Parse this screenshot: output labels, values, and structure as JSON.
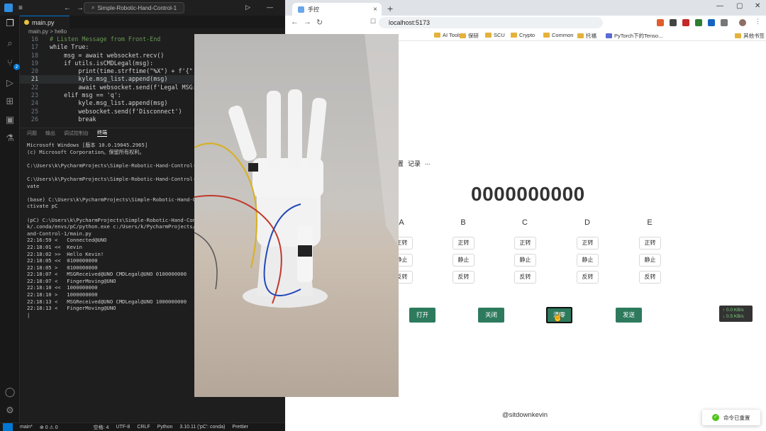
{
  "vscode": {
    "title": "Simple-Robotic-Hand-Control-1",
    "tab": "main.py",
    "breadcrumb": "main.py > hello",
    "code_lines": [
      {
        "n": "16",
        "text": "# Listen Message from Front-End"
      },
      {
        "n": "17",
        "text": "while True:"
      },
      {
        "n": "18",
        "text": "    msg = await websocket.recv()"
      },
      {
        "n": "19",
        "text": "    if utils.isCMDLegal(msg):"
      },
      {
        "n": "20",
        "text": "        print(time.strftime(\"%X\") + f'{\""
      },
      {
        "n": "21",
        "text": "        kyle.msg_list.append(msg)"
      },
      {
        "n": "22",
        "text": "        await websocket.send(f'Legal MSG:"
      },
      {
        "n": "23",
        "text": "    elif msg == 'q':"
      },
      {
        "n": "24",
        "text": "        kyle.msg_list.append(msg)"
      },
      {
        "n": "25",
        "text": "        websocket.send(f'Disconnect')"
      },
      {
        "n": "26",
        "text": "        break"
      }
    ],
    "panel_tabs": [
      "问题",
      "输出",
      "调试控制台",
      "终端"
    ],
    "terminal": [
      "Microsoft Windows [版本 10.0.19045.2965]",
      "(c) Microsoft Corporation。保留所有权利。",
      "",
      "C:\\Users\\k\\PycharmProjects\\Simple-Robotic-Hand-Control-1>act",
      "",
      "C:\\Users\\k\\PycharmProjects\\Simple-Robotic-Hand-Control-1>con",
      "vate",
      "",
      "(base) C:\\Users\\k\\PycharmProjects\\Simple-Robotic-Hand-Contro",
      "ctivate pC",
      "",
      "(pC) C:\\Users\\k\\PycharmProjects\\Simple-Robotic-Hand-Control-",
      "k/.conda/envs/pC/python.exe c:/Users/k/PycharmProjects/Simpl",
      "and-Control-1/main.py",
      "22:16:59 <   Connected@UNO",
      "22:18:01 <<  Kevin",
      "22:18:02 >>  Hello Kevin!",
      "22:18:05 <<  0100000000",
      "22:18:05 >   0100000000",
      "22:18:07 <   MSGReceived@UNO CMDLegal@UNO 0100000000",
      "22:18:07 <   FingerMoving@UNO",
      "22:18:10 <<  1000000000",
      "22:18:10 >   1000000000",
      "22:18:13 <   MSGReceived@UNO CMDLegal@UNO 1000000000",
      "22:18:13 <   FingerMoving@UNO",
      "|"
    ],
    "status": {
      "branch": "main*",
      "problems": "⊗ 0 ⚠ 0",
      "spaces": "空格: 4",
      "encoding": "UTF-8",
      "eol": "CRLF",
      "language": "Python",
      "interpreter": "3.10.11 ('pC': conda)",
      "prettier": "Prettier"
    }
  },
  "browser": {
    "tab_title": "手控",
    "url": "localhost:5173",
    "bookmarks": [
      "AI Tools",
      "保研",
      "SCU",
      "Crypto",
      "Common",
      "托福",
      "PyTorch下的Tenso...",
      "其他书签"
    ]
  },
  "app": {
    "menu": [
      "置",
      "记录",
      "..."
    ],
    "code": "0000000000",
    "columns": [
      "A",
      "B",
      "C",
      "D",
      "E"
    ],
    "motor_labels": [
      "正转",
      "静止",
      "反转"
    ],
    "buttons": {
      "open": "打开",
      "close": "关闭",
      "zero": "清零",
      "send": "发送"
    },
    "net_up": "↑ 0.0 KB/s",
    "net_down": "↓ 0.5 KB/s",
    "footer": "@sitdownkevin",
    "toast": "命令已重置"
  },
  "colors": {
    "button_green": "#2d7a5d",
    "vscode_accent": "#0078d4"
  }
}
